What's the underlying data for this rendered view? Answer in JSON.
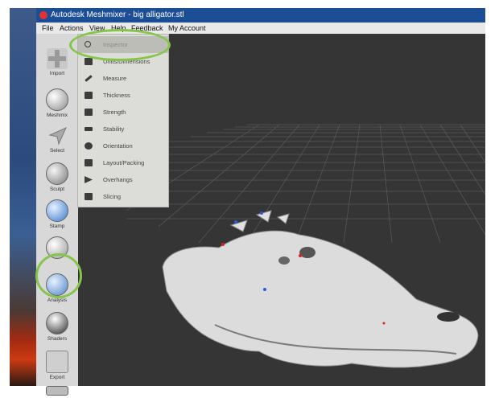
{
  "window": {
    "title": "Autodesk Meshmixer - big alligator.stl"
  },
  "menubar": [
    "File",
    "Actions",
    "View",
    "Help",
    "Feedback",
    "My Account"
  ],
  "toolbar": {
    "tools": [
      {
        "label": "Import",
        "icon": "plus-icon"
      },
      {
        "label": "Meshmix",
        "icon": "sphere-icon"
      },
      {
        "label": "Select",
        "icon": "cursor-arrow-icon"
      },
      {
        "label": "Sculpt",
        "icon": "brush-icon"
      },
      {
        "label": "Stamp",
        "icon": "stamp-icon"
      },
      {
        "label": "",
        "icon": "edit-mesh-icon"
      },
      {
        "label": "Analysis",
        "icon": "analysis-grid-icon"
      },
      {
        "label": "Shaders",
        "icon": "shader-ball-icon"
      },
      {
        "label": "Export",
        "icon": "export-arrow-icon"
      }
    ]
  },
  "analysis_menu": {
    "items": [
      {
        "label": "Inspector",
        "icon": "magnifier-icon",
        "highlighted": true
      },
      {
        "label": "Units/Dimensions",
        "icon": "ruler-icon"
      },
      {
        "label": "Measure",
        "icon": "pencil-measure-icon"
      },
      {
        "label": "Thickness",
        "icon": "thickness-icon"
      },
      {
        "label": "Strength",
        "icon": "strength-icon"
      },
      {
        "label": "Stability",
        "icon": "stability-icon"
      },
      {
        "label": "Orientation",
        "icon": "orientation-icon"
      },
      {
        "label": "Layout/Packing",
        "icon": "layout-icon"
      },
      {
        "label": "Overhangs",
        "icon": "overhang-icon"
      },
      {
        "label": "Slicing",
        "icon": "slicing-icon"
      }
    ]
  },
  "colors": {
    "titlebar": "#1c4e96",
    "viewport": "#353535",
    "highlight_circle": "#86c44a",
    "menu_bg": "#dcdcd8"
  }
}
